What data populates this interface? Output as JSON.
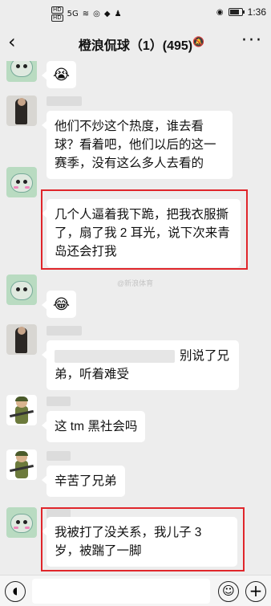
{
  "status_bar": {
    "chip_top": "HD",
    "chip_bottom": "HD",
    "signal_label": "5G",
    "time": "1:36"
  },
  "header": {
    "back_glyph": "‹",
    "title": "橙浪侃球（1）(495)",
    "mute_glyph": "🔕",
    "more_glyph": "···"
  },
  "messages": [
    {
      "sender": "cow",
      "type": "emoji",
      "text": "😭"
    },
    {
      "sender": "boss",
      "type": "text",
      "text": "他们不炒这个热度，谁去看球？看着吧，他们以后的这一赛季，没有这么多人去看的"
    },
    {
      "sender": "cow",
      "type": "text",
      "text": "几个人逼着我下跪，把我衣服撕了，扇了我 2 耳光，说下次来青岛还会打我",
      "highlighted": true
    },
    {
      "sender": "cow",
      "type": "emoji",
      "text": "😂"
    },
    {
      "sender": "boss",
      "type": "text",
      "text": "别说了兄弟，听着难受"
    },
    {
      "sender": "soldier",
      "type": "text",
      "text": "这 tm 黑社会吗"
    },
    {
      "sender": "soldier",
      "type": "text",
      "text": "辛苦了兄弟"
    },
    {
      "sender": "cow",
      "type": "text",
      "text": "我被打了没关系，我儿子 3 岁，被踹了一脚",
      "highlighted": true
    }
  ],
  "watermark": "@新浪体育",
  "input_bar": {
    "voice_icon": "voice-icon",
    "emoji_glyph": "☺",
    "plus_glyph": "+"
  },
  "colors": {
    "background": "#ededed",
    "bubble": "#ffffff",
    "highlight": "#e0262b"
  }
}
